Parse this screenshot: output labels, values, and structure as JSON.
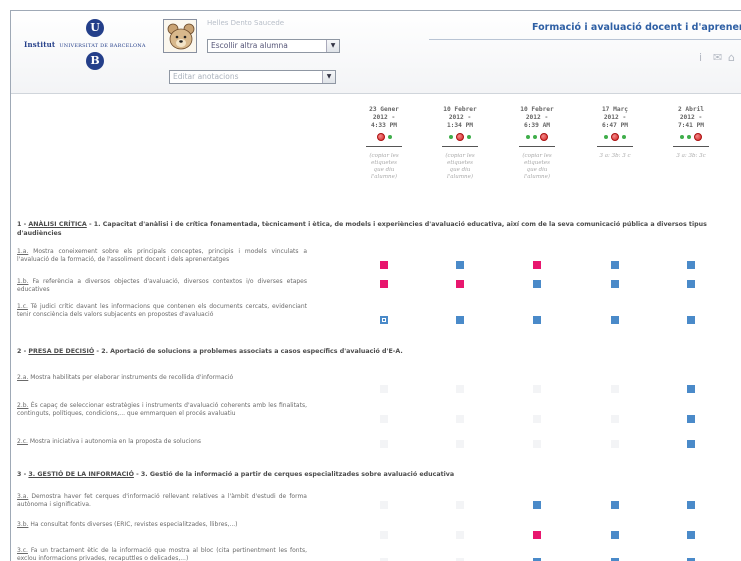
{
  "header": {
    "student_name": "Helles Dento Saucede",
    "student_select": "Escollir altra alumna",
    "annotations_select": "Editar anotacions",
    "app_title": "Formació i avaluació docent i d'aprenentatges",
    "logo": {
      "name_short": "Institut",
      "name_long": "UNIVERSITAT DE BARCELONA",
      "initial_top": "U",
      "initial_bottom": "B"
    },
    "icons": [
      "info-icon",
      "mail-icon",
      "home-icon"
    ],
    "icon_glyphs": [
      "i",
      "✉",
      "⌂"
    ]
  },
  "columns": [
    {
      "date": "23 Gener\n2012 -\n4:33 PM",
      "status": "red-first",
      "copy": "(copiar les\netiquetes\nque diu\nl'alumne)"
    },
    {
      "date": "10 Febrer\n2012 -\n1:34 PM",
      "status": "red-middle",
      "copy": "(copiar les\netiquetes\nque diu\nl'alumne)"
    },
    {
      "date": "10 Febrer\n2012 -\n6:39 AM",
      "status": "red-last",
      "copy": "(copiar les\netiquetes\nque diu\nl'alumne)"
    },
    {
      "date": "17 Març\n2012 -\n6:47 PM",
      "status": "red-middle",
      "copy": "3 a: 3b: 3 c"
    },
    {
      "date": "2 Abril\n2012 -\n7:41 PM",
      "status": "red-last",
      "copy": "3 a: 3b: 3c"
    }
  ],
  "sections": [
    {
      "prefix": "1 - ",
      "code": "ANÀLISI CRÍTICA",
      "text": " - 1. Capacitat d'anàlisi i de crítica fonamentada, tècnicament i ètica, de models i experiències d'avaluació educativa, així com de la seva comunicació pública a diversos tipus d'audiències",
      "indicators": [
        {
          "code": "1.a.",
          "text": " Mostra coneixement sobre els principals conceptes, principis i models vinculats a l'avaluació de la formació, de l'assoliment docent i dels aprenentatges",
          "cells": [
            "m",
            "b",
            "m",
            "b",
            "b"
          ]
        },
        {
          "code": "1.b.",
          "text": " Fa referència a diversos objectes d'avaluació, diversos contextos i/o diverses etapes educatives",
          "cells": [
            "m",
            "m",
            "b",
            "b",
            "b"
          ]
        },
        {
          "code": "1.c.",
          "text": " Té judici crític davant les informacions que contenen els documents cercats, evidenciant tenir consciència dels valors subjacents en propostes d'avaluació",
          "cells": [
            "o",
            "b",
            "b",
            "b",
            "b"
          ]
        }
      ]
    },
    {
      "prefix": "2 - ",
      "code": "PRESA DE DECISIÓ",
      "text": " - 2. Aportació de solucions a problemes associats a casos específics d'avaluació d'E-A.",
      "indicators": [
        {
          "code": "2.a.",
          "text": " Mostra habilitats per elaborar instruments de recollida d'informació",
          "cells": [
            "w",
            "w",
            "w",
            "w",
            "b"
          ]
        },
        {
          "code": "2.b.",
          "text": " És capaç de seleccionar estratègies i instruments d'avaluació coherents amb les finalitats, continguts, polítiques, condicions,... que emmarquen el procés avaluatiu",
          "cells": [
            "w",
            "w",
            "w",
            "w",
            "b"
          ]
        },
        {
          "code": "2.c.",
          "text": " Mostra iniciativa i autonomia en la proposta de solucions",
          "cells": [
            "w",
            "w",
            "w",
            "w",
            "b"
          ]
        }
      ]
    },
    {
      "prefix": "3 - ",
      "code": "3. GESTIÓ DE LA INFORMACIÓ",
      "text": " - 3. Gestió de la informació a partir de cerques especialitzades sobre avaluació educativa",
      "indicators": [
        {
          "code": "3.a.",
          "text": " Demostra haver fet cerques d'informació rellevant relatives a l'àmbit d'estudi de forma autònoma i significativa.",
          "cells": [
            "w",
            "w",
            "b",
            "b",
            "b"
          ]
        },
        {
          "code": "3.b.",
          "text": " Ha consultat fonts diverses (ERIC, revistes especialitzades, llibres,...)",
          "cells": [
            "w",
            "w",
            "m",
            "b",
            "b"
          ]
        },
        {
          "code": "3.c.",
          "text": " Fa un tractament ètic de la informació que mostra al bloc (cita pertinentment les fonts, exclou informacions privades, recaputtles o delicades,...)",
          "cells": [
            "w",
            "w",
            "b",
            "b",
            "b"
          ]
        }
      ]
    }
  ]
}
